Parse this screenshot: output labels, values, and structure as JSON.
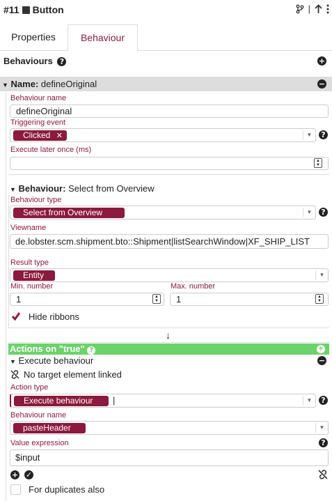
{
  "header": {
    "title": "#11",
    "component": "Button"
  },
  "tabs": [
    {
      "label": "Properties"
    },
    {
      "label": "Behaviour"
    }
  ],
  "behaviours_title": "Behaviours",
  "name_section": {
    "label_bold": "Name:",
    "label_value": "defineOriginal"
  },
  "behaviour_name": {
    "label": "Behaviour name",
    "value": "defineOriginal"
  },
  "triggering_event": {
    "label": "Triggering event",
    "value": "Clicked"
  },
  "execute_later": {
    "label": "Execute later once (ms)",
    "value": ""
  },
  "behaviour_section": {
    "label_bold": "Behaviour:",
    "label_value": "Select from Overview"
  },
  "behaviour_type": {
    "label": "Behaviour type",
    "value": "Select from Overview"
  },
  "viewname": {
    "label": "Viewname",
    "value": "de.lobster.scm.shipment.bto::Shipment|listSearchWindow|XF_SHIP_LIST"
  },
  "result_type": {
    "label": "Result type",
    "value": "Entity"
  },
  "min_number": {
    "label": "Min. number",
    "value": "1"
  },
  "max_number": {
    "label": "Max. number",
    "value": "1"
  },
  "hide_ribbons": {
    "label": "Hide ribbons",
    "checked": true
  },
  "arrow_glyph": "↓",
  "actions": {
    "label": "Actions on \"true\""
  },
  "execute_behaviour_section": {
    "label": "Execute behaviour"
  },
  "no_target": {
    "label": "No target element linked"
  },
  "action_type": {
    "label": "Action type",
    "value": "Execute behaviour"
  },
  "behaviour_name2": {
    "label": "Behaviour name",
    "value": "pasteHeader"
  },
  "value_expression": {
    "label": "Value expression",
    "value": "$input"
  },
  "duplicates": {
    "label": "For duplicates also",
    "checked": false
  },
  "colors": {
    "accent": "#8b1a3e",
    "green": "#6cd26c",
    "grey_bar": "#dddddd"
  },
  "icons": [
    "branch-icon",
    "arrow-up-icon",
    "more-vertical-icon",
    "help-icon",
    "plus-circle-icon",
    "minus-circle-icon",
    "unlink-icon",
    "check-circle-icon",
    "close-icon",
    "caret-down-icon"
  ]
}
